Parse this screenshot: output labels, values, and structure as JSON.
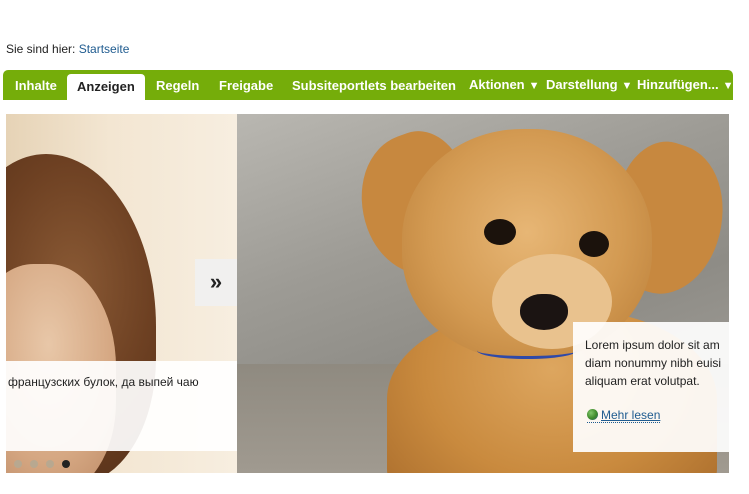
{
  "breadcrumb": {
    "prefix": "Sie sind hier:",
    "link": "Startseite"
  },
  "toolbar": {
    "tabs": [
      {
        "label": "Inhalte",
        "active": false
      },
      {
        "label": "Anzeigen",
        "active": true
      },
      {
        "label": "Regeln",
        "active": false
      },
      {
        "label": "Freigabe",
        "active": false
      },
      {
        "label": "Subsiteportlets bearbeiten",
        "active": false
      }
    ],
    "menus": [
      {
        "label": "Aktionen",
        "caret": "▼"
      },
      {
        "label": "Darstellung",
        "caret": "▼"
      },
      {
        "label": "Hinzufügen...",
        "caret": "▼"
      }
    ],
    "color": "#75ad0a"
  },
  "slider": {
    "left_caption": "французских булок, да выпей чаю",
    "next_symbol": "»",
    "right_caption_lines": [
      "Lorem ipsum dolor sit am",
      "diam nonummy nibh euisi",
      "aliquam erat volutpat."
    ],
    "read_more": "Mehr lesen",
    "dots_total": 4,
    "active_dot": 4
  }
}
